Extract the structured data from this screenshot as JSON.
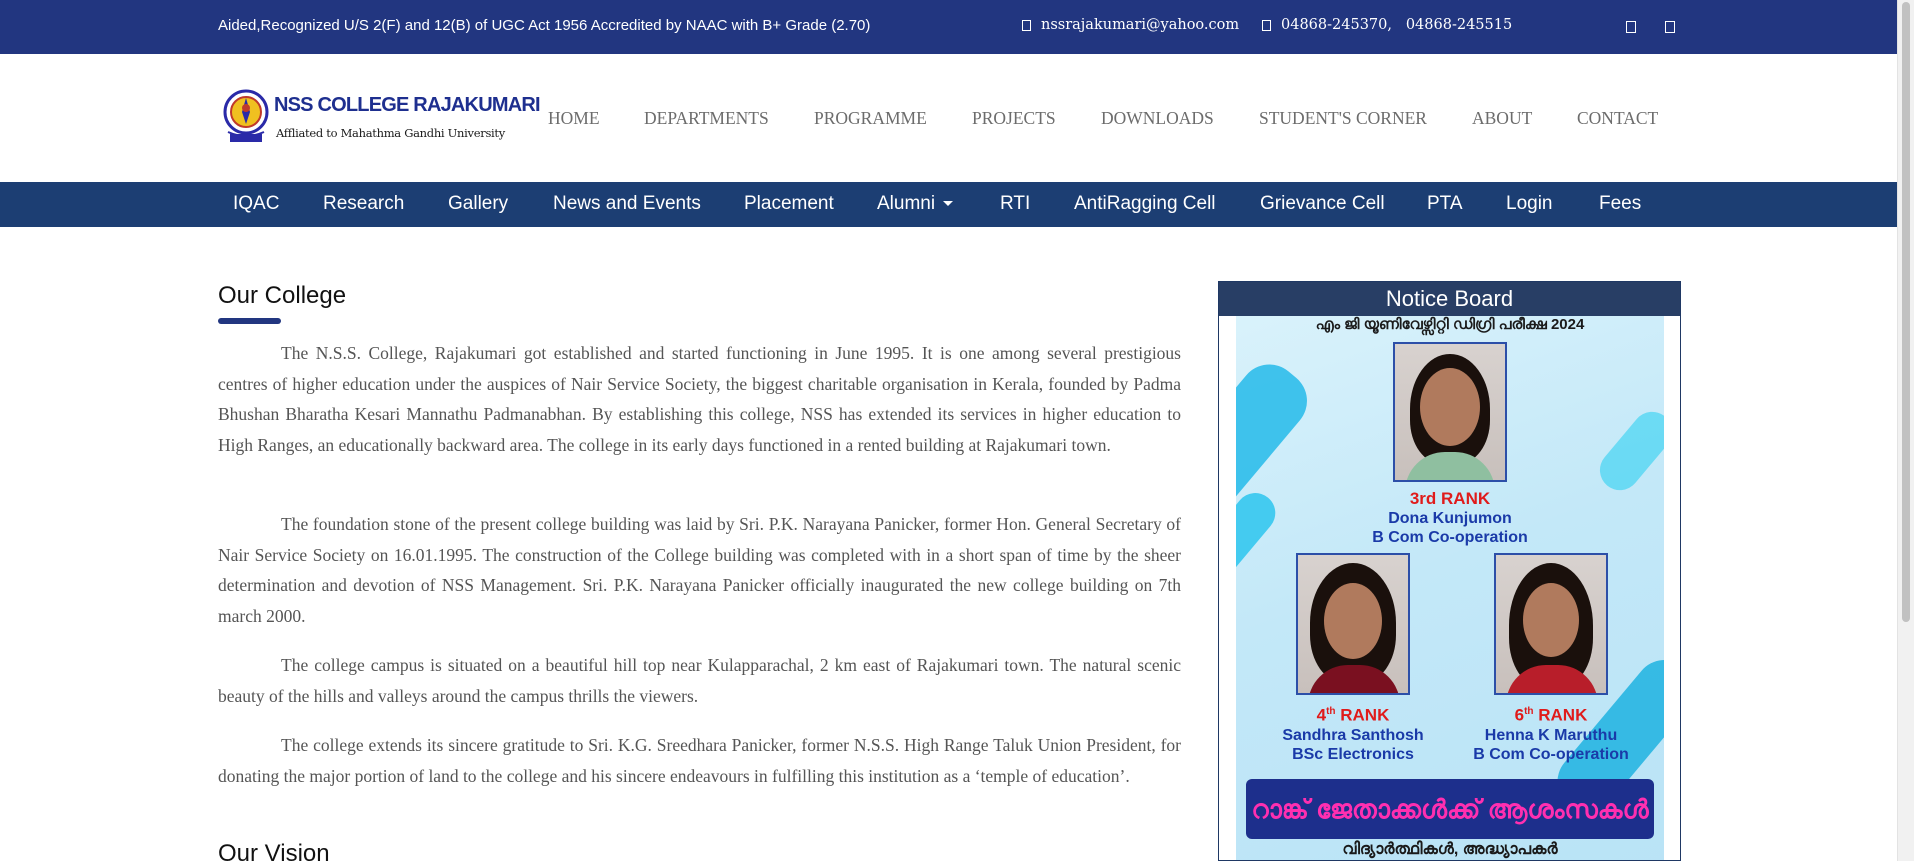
{
  "topbar": {
    "accreditation": "Aided,Recognized U/S 2(F) and 12(B) of UGC Act 1956 Accredited by NAAC with B+ Grade (2.70)",
    "email": "nssrajakumari@yahoo.com",
    "phone": "04868-245370,   04868-245515",
    "icons": [
      "envelope-icon",
      "phone-icon",
      "facebook-icon",
      "youtube-icon"
    ]
  },
  "logo": {
    "name": "NSS COLLEGE RAJAKUMARI",
    "affiliation": "Affliated to Mahathma Gandhi University"
  },
  "main_nav": {
    "home": "HOME",
    "departments": "DEPARTMENTS",
    "programme": "PROGRAMME",
    "projects": "PROJECTS",
    "downloads": "DOWNLOADS",
    "students_corner": "STUDENT'S CORNER",
    "about": "ABOUT",
    "contact": "CONTACT"
  },
  "sub_nav": {
    "iqac": "IQAC",
    "research": "Research",
    "gallery": "Gallery",
    "news": "News and Events",
    "placement": "Placement",
    "alumni": "Alumni",
    "rti": "RTI",
    "antiragging": "AntiRagging Cell",
    "grievance": "Grievance Cell",
    "pta": "PTA",
    "login": "Login",
    "fees": "Fees"
  },
  "content": {
    "title": "Our College",
    "paragraphs": [
      "The N.S.S. College, Rajakumari got established and started functioning in June 1995. It is one among several prestigious centres of higher education under the auspices of Nair Service Society, the biggest charitable organisation in Kerala, founded by Padma Bhushan Bharatha Kesari Mannathu Padmanabhan. By establishing this college, NSS has extended its services in higher education to High Ranges, an educationally backward area. The college in its early days functioned in a rented building at Rajakumari town.",
      "The foundation stone of the present college building was laid by Sri. P.K. Narayana Panicker, former Hon. General Secretary of Nair Service Society on 16.01.1995. The construction of the College building was completed with in a short span of time by the sheer determination and devotion of NSS Management. Sri. P.K. Narayana Panicker officially inaugurated the new college building on 7th march 2000.",
      "The college campus is situated on a beautiful hill top near Kulapparachal, 2 km east of Rajakumari town. The natural scenic beauty of the hills and valleys around the campus thrills the viewers.",
      "The college extends its sincere gratitude to Sri. K.G. Sreedhara Panicker, former N.S.S. High Range Taluk Union President, for donating the major portion of land to the college and his sincere endeavours in fulfilling this institution as a ‘temple of education’."
    ],
    "subtitle": "Our Vision"
  },
  "notice_board": {
    "heading": "Notice Board",
    "poster_top": "എം ജി യൂണിവേഴ്സിറ്റി ഡിഗ്രി പരീക്ഷ 2024",
    "ranks": [
      {
        "rank": "3rd RANK",
        "name": "Dona Kunjumon",
        "course": "B Com Co-operation"
      },
      {
        "rank_num": "4",
        "rank_suffix": "th",
        "rank_word": " RANK",
        "name": "Sandhra Santhosh",
        "course": "BSc Electronics"
      },
      {
        "rank_num": "6",
        "rank_suffix": "th",
        "rank_word": " RANK",
        "name": "Henna K Maruthu",
        "course": "B Com Co-operation"
      }
    ],
    "banner": "റാങ്ക് ജേതാക്കൾക്ക് ആശംസകൾ",
    "banner_sub": "വിദ്യാർത്ഥികൾ, അദ്ധ്യാപകർ"
  }
}
